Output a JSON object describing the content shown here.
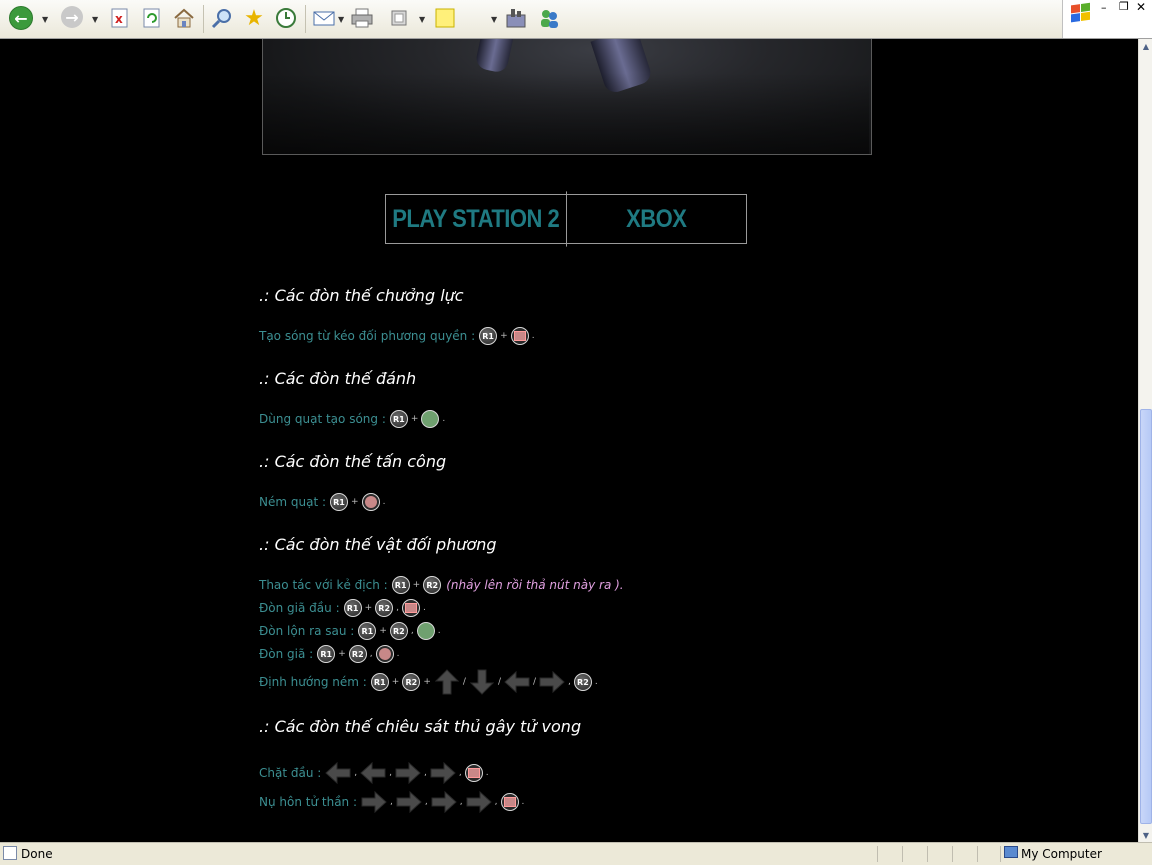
{
  "toolbar": {
    "icons": [
      "back-icon",
      "forward-icon",
      "stop-icon",
      "refresh-icon",
      "home-icon",
      "search-icon",
      "favorites-icon",
      "history-icon",
      "mail-icon",
      "print-icon",
      "fullscreen-icon",
      "notes-icon",
      "messenger-icon",
      "users-icon"
    ]
  },
  "colors": {
    "page_bg": "#000000",
    "tab_text": "#1f7a82",
    "body_text": "#3c8f92",
    "heading": "#ffffff",
    "note": "#e0a0e0"
  },
  "tabs": {
    "ps2": "PLAY STATION 2",
    "xbox": "XBOX"
  },
  "sections": {
    "s1": {
      "title": ".: Các đòn thế chưởng lực",
      "l1": "Tạo sóng từ kéo đối phương quyền :"
    },
    "s2": {
      "title": ".: Các đòn thế đánh",
      "l1": "Dùng quạt tạo sóng :"
    },
    "s3": {
      "title": ".: Các đòn thế tấn công",
      "l1": "Ném quạt :"
    },
    "s4": {
      "title": ".: Các đòn thế vật đối phương",
      "l1": "Thao tác với kẻ địch :",
      "l1_note": "(nhảy lên rồi thả nút này ra ).",
      "l2": "Đòn giã đầu :",
      "l3": "Đòn lộn ra sau :",
      "l4": "Đòn giã :",
      "l5": "Định hướng ném :"
    },
    "s5": {
      "title": ".: Các đòn thế chiêu sát thủ gây tử vong",
      "l1": "Chặt đầu :",
      "l2": "Nụ hôn tử thần :"
    }
  },
  "buttons": {
    "r1": "R1",
    "r2": "R2",
    "plus": "+",
    "comma": ",",
    "period": ".",
    "slash": "/"
  },
  "status": {
    "left": "Done",
    "zone": "My Computer"
  }
}
